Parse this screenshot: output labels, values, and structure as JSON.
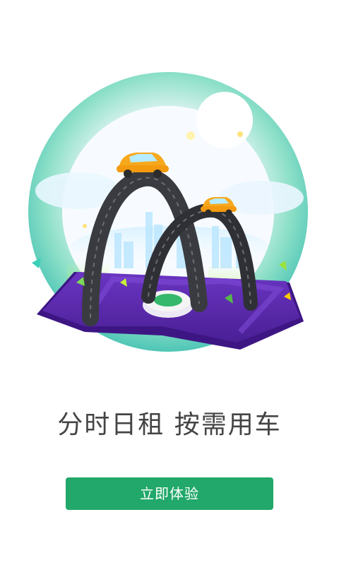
{
  "splash": {
    "tagline": "分时日租 按需用车",
    "cta_label": "立即体验"
  },
  "colors": {
    "accent": "#21a86a",
    "ring": "#5fd3b0",
    "platform": "#5b2aa6",
    "glow": "#9be23b",
    "car": "#f5a623"
  },
  "icons": {
    "hero": "city-car-illustration"
  }
}
